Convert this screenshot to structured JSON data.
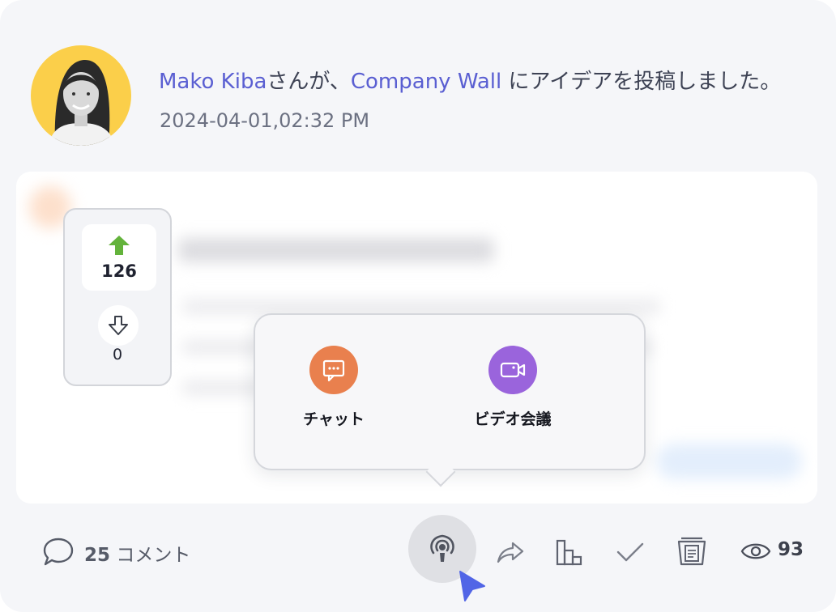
{
  "post": {
    "author": "Mako Kiba",
    "text_connector": "さんが、",
    "wall_name": "Company Wall",
    "text_suffix": " にアイデアを投稿しました。",
    "timestamp": "2024-04-01,02:32 PM"
  },
  "vote": {
    "upvotes": "126",
    "downvotes": "0"
  },
  "popover": {
    "chat_label": "チャット",
    "video_label": "ビデオ会議"
  },
  "toolbar": {
    "comment_count": "25",
    "comment_label": " コメント",
    "view_count": "93"
  },
  "colors": {
    "link": "#5a5fd2",
    "avatar_bg": "#fbcf4a",
    "upvote_green": "#63b33b",
    "chat_orange": "#e9804e",
    "video_purple": "#9a64dc",
    "cursor_blue": "#5165e6"
  },
  "icons": {
    "comment": "speech-bubble-icon",
    "live": "broadcast-icon",
    "share": "share-arrow-icon",
    "stats": "bar-chart-icon",
    "check": "checkmark-icon",
    "notes": "document-icon",
    "views": "eye-icon"
  }
}
